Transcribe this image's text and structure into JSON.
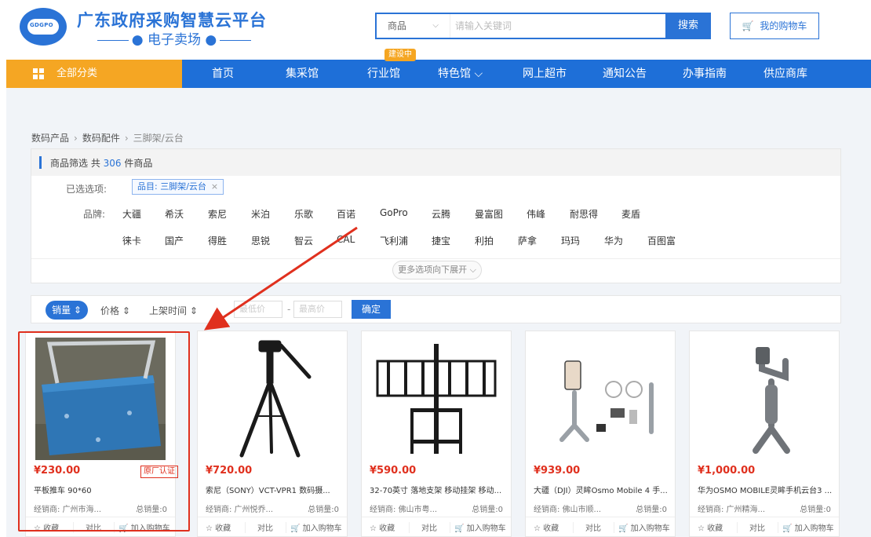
{
  "header": {
    "site_title": "广东政府采购智慧云平台",
    "site_subtitle": "电子卖场",
    "logo_text": "GDGPO",
    "search": {
      "category": "商品",
      "placeholder": "请输入关键词",
      "button_label": "搜索"
    },
    "cart_label": "我的购物车"
  },
  "nav": {
    "all_categories": "全部分类",
    "items": [
      "首页",
      "集采馆",
      "行业馆",
      "特色馆 ⌵",
      "网上超市",
      "通知公告",
      "办事指南",
      "供应商库"
    ],
    "badge": "建设中"
  },
  "breadcrumb": [
    "数码产品",
    "数码配件",
    "三脚架/云台"
  ],
  "filter": {
    "heading_prefix": "商品筛选 共",
    "count": "306",
    "heading_suffix": "件商品",
    "selected_label": "已选选项:",
    "selected_tag": "品目: 三脚架/云台",
    "brand_label": "品牌:",
    "brands_row1": [
      "大疆",
      "希沃",
      "索尼",
      "米泊",
      "乐歌",
      "百诺",
      "GoPro",
      "云腾",
      "曼富图",
      "伟峰",
      "耐思得",
      "麦盾"
    ],
    "brands_row2": [
      "徕卡",
      "国产",
      "得胜",
      "思锐",
      "智云",
      "CAL",
      "飞利浦",
      "捷宝",
      "利拍",
      "萨拿",
      "玛玛",
      "华为",
      "百图富"
    ],
    "more": "更多选项向下展开 ⌵"
  },
  "sort": {
    "active": "销量 ⇕",
    "price": "价格 ⇕",
    "shelf_time": "上架时间 ⇕",
    "min_placeholder": "最低价",
    "max_placeholder": "最高价",
    "dash": "-",
    "confirm": "确定"
  },
  "products": [
    {
      "price": "¥230.00",
      "name": "平板推车 90*60",
      "dealer": "经销商: 广州市海...",
      "sales": "总销量:0",
      "tag": "原厂认证"
    },
    {
      "price": "¥720.00",
      "name": "索尼（SONY）VCT-VPR1 数码摄...",
      "dealer": "经销商: 广州悦乔...",
      "sales": "总销量:0",
      "tag": ""
    },
    {
      "price": "¥590.00",
      "name": "32-70英寸 落地支架 移动挂架 移动...",
      "dealer": "经销商: 佛山市粤...",
      "sales": "总销量:0",
      "tag": ""
    },
    {
      "price": "¥939.00",
      "name": "大疆（DJI）灵眸Osmo Mobile 4 手...",
      "dealer": "经销商: 佛山市顺...",
      "sales": "总销量:0",
      "tag": ""
    },
    {
      "price": "¥1,000.00",
      "name": "华为OSMO MOBILE灵眸手机云台3 ...",
      "dealer": "经销商: 广州精海...",
      "sales": "总销量:0",
      "tag": ""
    }
  ],
  "card_actions": {
    "favorite": "☆ 收藏",
    "compare": "对比",
    "add_cart": "🛒 加入购物车"
  },
  "colors": {
    "primary": "#2a73d6",
    "nav_orange": "#f5a623",
    "price_red": "#e0301e"
  }
}
